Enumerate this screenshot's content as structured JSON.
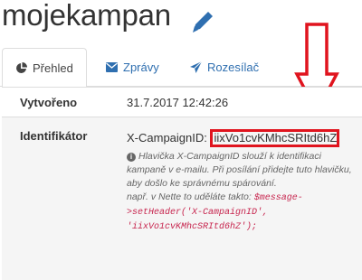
{
  "header": {
    "title": "mojekampan",
    "edit_icon": "pencil-icon"
  },
  "tabs": [
    {
      "label": "Přehled",
      "icon": "pie-chart-icon",
      "active": true
    },
    {
      "label": "Zprávy",
      "icon": "envelope-icon",
      "active": false
    },
    {
      "label": "Rozesílač",
      "icon": "send-icon",
      "active": false
    }
  ],
  "details": {
    "created_label": "Vytvořeno",
    "created_value": "31.7.2017 12:42:26",
    "identifier_label": "Identifikátor",
    "campaign_prefix": "X-CampaignID: ",
    "campaign_id": "iixVo1cvKMhcSRItd6hZ",
    "help_line1": "Hlavička X-CampaignID slouží k identifikaci kampaně v e-mailu. Při posílání přidejte tuto hlavičku, aby došlo ke správnému spárování.",
    "help_line2": "např. v Nette to uděláte takto:",
    "code_snippet": "$message->setHeader('X-CampaignID', 'iixVo1cvKMhcSRItd6hZ');"
  },
  "colors": {
    "accent_link": "#2f6fb0",
    "highlight_red": "#e0141e",
    "code": "#c7254e"
  }
}
